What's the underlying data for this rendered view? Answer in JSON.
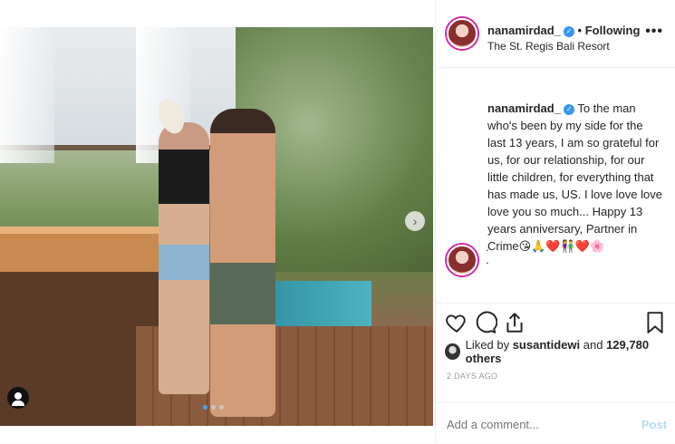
{
  "header": {
    "username": "nanamirdad_",
    "verified_icon": "verified-badge-icon",
    "separator": "•",
    "following_label": "Following",
    "location": "The St. Regis Bali Resort",
    "more_label": "•••"
  },
  "caption": {
    "username": "nanamirdad_",
    "text": "To the man who's been by my side for the last 13 years, I am so grateful for us, for our relationship, for our little children, for everything that has made us, US. I love love love love you so much... Happy 13 years anniversary, Partner in Crime😘🙏❤️👫❤️🌸",
    "extra_lines": [
      ".",
      "."
    ]
  },
  "photo": {
    "carousel_total": 3,
    "carousel_active": 0
  },
  "likes": {
    "prefix": "Liked by",
    "first_user": "susantidewi",
    "connector": "and",
    "count_text": "129,780 others"
  },
  "date": "2 DAYS AGO",
  "comment": {
    "placeholder": "Add a comment...",
    "post_label": "Post"
  },
  "colors": {
    "verified": "#3897f0",
    "post_disabled": "#b7d8f7",
    "ring": "#d6249f"
  }
}
